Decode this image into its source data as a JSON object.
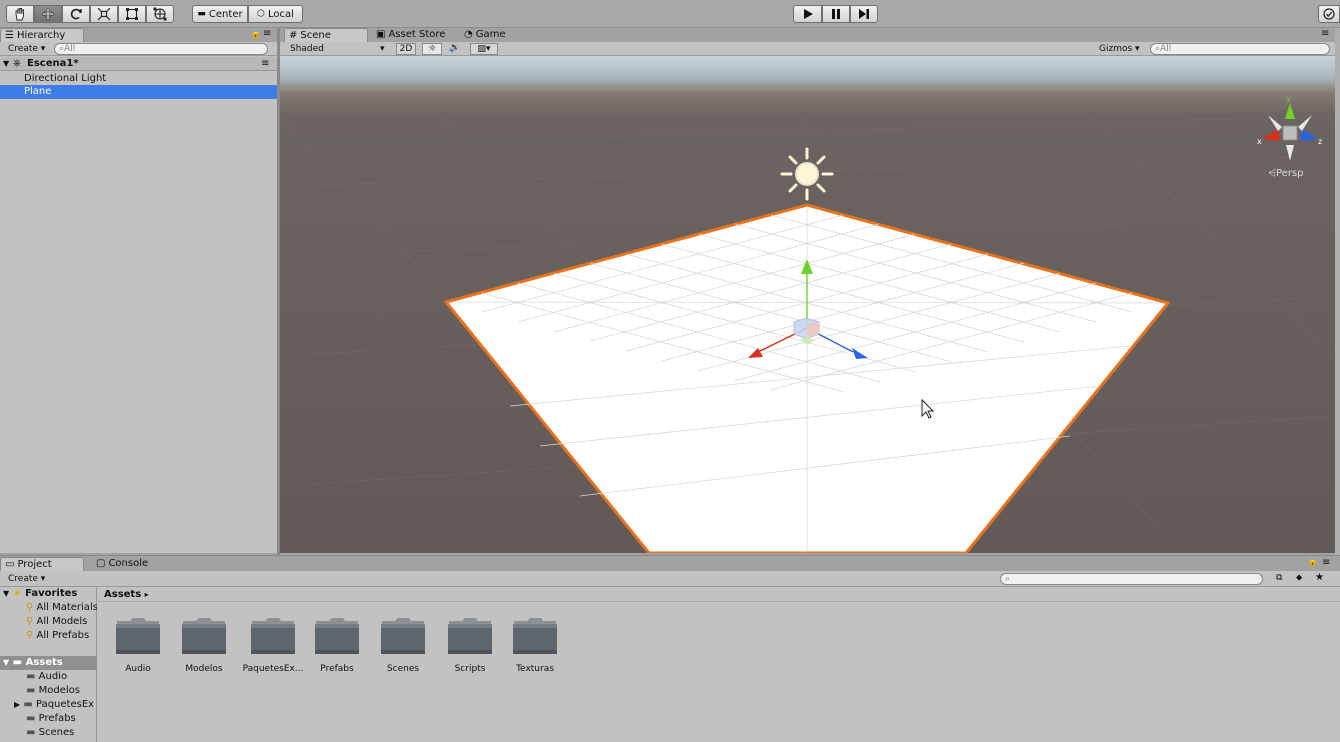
{
  "toolbar": {
    "tools": [
      "hand-tool",
      "move-tool",
      "rotate-tool",
      "scale-tool",
      "rect-tool",
      "transform-tool"
    ],
    "pivot_label": "Center",
    "space_label": "Local"
  },
  "hierarchy": {
    "tab_label": "Hierarchy",
    "create_label": "Create",
    "search_placeholder": "All",
    "scene_name": "Escena1*",
    "items": [
      {
        "label": "Directional Light",
        "selected": false
      },
      {
        "label": "Plane",
        "selected": true
      }
    ]
  },
  "scene": {
    "tabs": [
      {
        "label": "Scene",
        "active": true
      },
      {
        "label": "Asset Store",
        "active": false
      },
      {
        "label": "Game",
        "active": false
      }
    ],
    "shading_mode": "Shaded",
    "mode_2d_label": "2D",
    "gizmos_label": "Gizmos",
    "search_placeholder": "All",
    "view_mode": "Persp",
    "axis_x": "x",
    "axis_y": "y",
    "axis_z": "z"
  },
  "project": {
    "tabs": [
      {
        "label": "Project",
        "active": true
      },
      {
        "label": "Console",
        "active": false
      }
    ],
    "create_label": "Create",
    "breadcrumb": "Assets",
    "favorites_label": "Favorites",
    "favorites": [
      "All Materials",
      "All Models",
      "All Prefabs"
    ],
    "assets_label": "Assets",
    "asset_tree": [
      "Audio",
      "Modelos",
      "PaquetesEx",
      "Prefabs",
      "Scenes"
    ],
    "folders": [
      "Audio",
      "Modelos",
      "PaquetesEx...",
      "Prefabs",
      "Scenes",
      "Scripts",
      "Texturas"
    ]
  },
  "colors": {
    "selection": "#3e7de6",
    "plane_outline": "#e8731e",
    "axis_x": "#d8321e",
    "axis_y": "#6fd12a",
    "axis_z": "#2a64e0"
  }
}
